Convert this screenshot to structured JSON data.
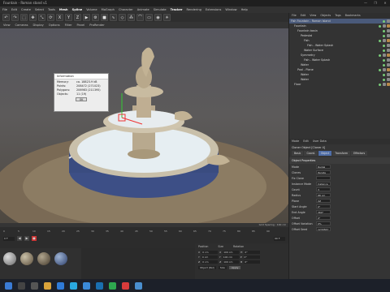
{
  "window": {
    "title": "Fountain - Roman stand v1",
    "controls": [
      "—",
      "❐",
      "✕"
    ]
  },
  "menubar": {
    "items": [
      "File",
      "Edit",
      "Create",
      "Select",
      "Tools",
      "Mesh",
      "Spline",
      "Volume",
      "MoGraph",
      "Character",
      "Animate",
      "Simulate",
      "Tracker",
      "Rendering",
      "Extensions",
      "Window",
      "Help"
    ],
    "highlight": [
      5,
      6,
      12
    ]
  },
  "viewport": {
    "menu": [
      "View",
      "Cameras",
      "Display",
      "Options",
      "Filter",
      "Panel",
      "ProRender"
    ],
    "status_right": "Grid Spacing : 100 cm"
  },
  "info_dialog": {
    "title": "Information",
    "rows": [
      {
        "label": "Memory:",
        "value": "ca. 18823.9 kB"
      },
      {
        "label": "Points:",
        "value": "208472 (271023)"
      },
      {
        "label": "Polygons:",
        "value": "206983 (211395)"
      },
      {
        "label": "Objects:",
        "value": "11 (19)"
      }
    ],
    "ok": "OK"
  },
  "object_manager": {
    "menu": [
      "File",
      "Edit",
      "View",
      "Objects",
      "Tags",
      "Bookmarks"
    ],
    "items": [
      "Fish Fountain - Roman Island",
      "Fountain",
      "Fountain basin",
      "Pedestal",
      "Fish",
      "Fish - Water Splash",
      "Water Surface",
      "Symmetry",
      "Fish - Water Splash",
      "Water",
      "Pool - Plane",
      "Water",
      "Water",
      "Floor"
    ]
  },
  "attribute_manager": {
    "menu": [
      "Mode",
      "Edit",
      "User Data"
    ],
    "title": "Cloner Object [Cloner 4]",
    "tabs": [
      "Basic",
      "Coord.",
      "Object",
      "Transform",
      "Effectors"
    ],
    "section": "Object Properties",
    "rows": [
      {
        "label": "Mode",
        "value": "Radial"
      },
      {
        "label": "Clones",
        "value": "Iterate"
      },
      {
        "label": "Fix Clone",
        "value": ""
      },
      {
        "label": "Instance Mode",
        "value": "Instance"
      },
      {
        "label": "Count",
        "value": "3"
      },
      {
        "label": "Radius",
        "value": "88 cm"
      },
      {
        "label": "Plane",
        "value": "XZ"
      },
      {
        "label": "Start Angle",
        "value": "0°"
      },
      {
        "label": "End Angle",
        "value": "360°"
      },
      {
        "label": "Offset",
        "value": "0°"
      },
      {
        "label": "Offset Variation",
        "value": "0%"
      },
      {
        "label": "Offset Seed",
        "value": "1234567"
      }
    ]
  },
  "coordinates": {
    "headers": [
      "Position",
      "Size",
      "Rotation"
    ],
    "rows": [
      [
        "X",
        "0 cm",
        "X",
        "100 cm",
        "H",
        "0°"
      ],
      [
        "Y",
        "0 cm",
        "Y",
        "100 cm",
        "P",
        "0°"
      ],
      [
        "Z",
        "0 cm",
        "Z",
        "100 cm",
        "B",
        "0°"
      ]
    ],
    "mode": "Object (Rel)",
    "size_mode": "Size",
    "apply": "Apply"
  },
  "timeline": {
    "frames": [
      "0",
      "5",
      "10",
      "15",
      "20",
      "25",
      "30",
      "35",
      "40",
      "45",
      "50",
      "55",
      "60",
      "65",
      "70",
      "75",
      "80",
      "85",
      "90"
    ],
    "start": "0 F",
    "end": "90 F"
  }
}
